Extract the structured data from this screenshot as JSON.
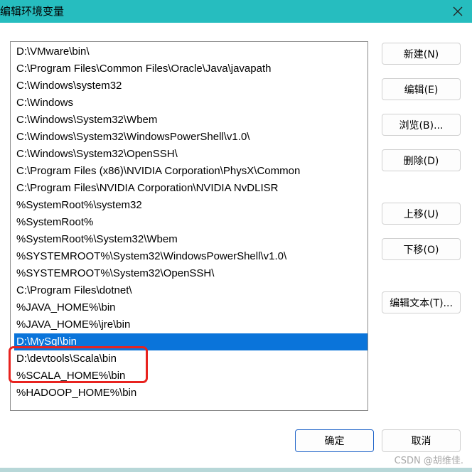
{
  "window": {
    "title": "编辑环境变量"
  },
  "path_list": {
    "items": [
      "D:\\VMware\\bin\\",
      "C:\\Program Files\\Common Files\\Oracle\\Java\\javapath",
      "C:\\Windows\\system32",
      "C:\\Windows",
      "C:\\Windows\\System32\\Wbem",
      "C:\\Windows\\System32\\WindowsPowerShell\\v1.0\\",
      "C:\\Windows\\System32\\OpenSSH\\",
      "C:\\Program Files (x86)\\NVIDIA Corporation\\PhysX\\Common",
      "C:\\Program Files\\NVIDIA Corporation\\NVIDIA NvDLISR",
      "%SystemRoot%\\system32",
      "%SystemRoot%",
      "%SystemRoot%\\System32\\Wbem",
      "%SYSTEMROOT%\\System32\\WindowsPowerShell\\v1.0\\",
      "%SYSTEMROOT%\\System32\\OpenSSH\\",
      "C:\\Program Files\\dotnet\\",
      "%JAVA_HOME%\\bin",
      "%JAVA_HOME%\\jre\\bin",
      "D:\\MySql\\bin",
      "D:\\devtools\\Scala\\bin",
      "%SCALA_HOME%\\bin",
      "%HADOOP_HOME%\\bin"
    ],
    "selected_index": 17
  },
  "buttons": {
    "new": "新建(N)",
    "edit": "编辑(E)",
    "browse": "浏览(B)...",
    "delete": "删除(D)",
    "move_up": "上移(U)",
    "move_down": "下移(O)",
    "edit_text": "编辑文本(T)...",
    "ok": "确定",
    "cancel": "取消"
  },
  "watermark": "CSDN @胡维佳.",
  "colors": {
    "titlebar": "#26bdbf",
    "selection": "#0a74da",
    "annotation": "#e8231f"
  },
  "icons": {
    "close": "close-icon"
  }
}
